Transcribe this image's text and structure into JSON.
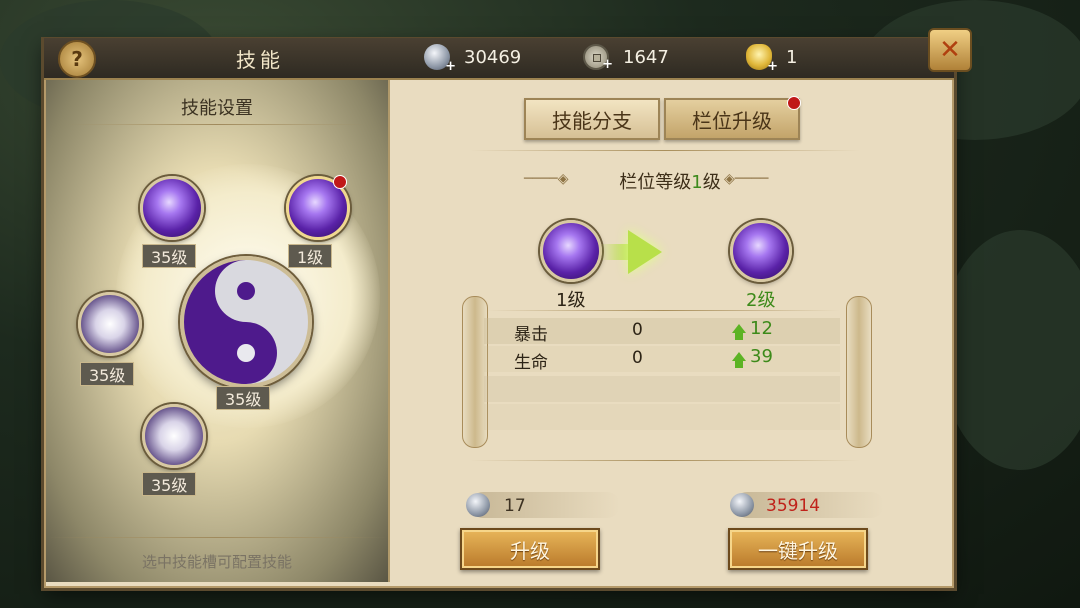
{
  "header": {
    "title": "技能",
    "help_label": "?",
    "close_label": "✕",
    "currencies": [
      {
        "icon": "silver-icon",
        "value": "30469"
      },
      {
        "icon": "copper-coin-icon",
        "value": "1647"
      },
      {
        "icon": "gold-ingot-icon",
        "value": "1"
      }
    ],
    "add_label": "+"
  },
  "left_panel": {
    "title": "技能设置",
    "hint": "选中技能槽可配置技能",
    "slots": [
      {
        "level": "35级"
      },
      {
        "level": "1级"
      },
      {
        "level": "35级"
      },
      {
        "level": "35级"
      },
      {
        "level": "35级"
      }
    ]
  },
  "tabs": [
    {
      "label": "技能分支"
    },
    {
      "label": "栏位升级"
    }
  ],
  "upgrade": {
    "section_title_prefix": "栏位等级",
    "section_title_num": "1",
    "section_title_suffix": "级",
    "current_level": "1级",
    "next_level": "2级",
    "stats": [
      {
        "name": "暴击",
        "current": "0",
        "increase": "12"
      },
      {
        "name": "生命",
        "current": "0",
        "increase": "39"
      }
    ],
    "costs": [
      {
        "icon": "silver-icon",
        "value": "17"
      },
      {
        "icon": "silver-icon",
        "value": "35914"
      }
    ],
    "upgrade_label": "升级",
    "one_key_upgrade_label": "一键升级"
  },
  "colors": {
    "accent_green": "#3d8a1a",
    "cost_red": "#c0221a",
    "notification_red": "#c01818"
  }
}
